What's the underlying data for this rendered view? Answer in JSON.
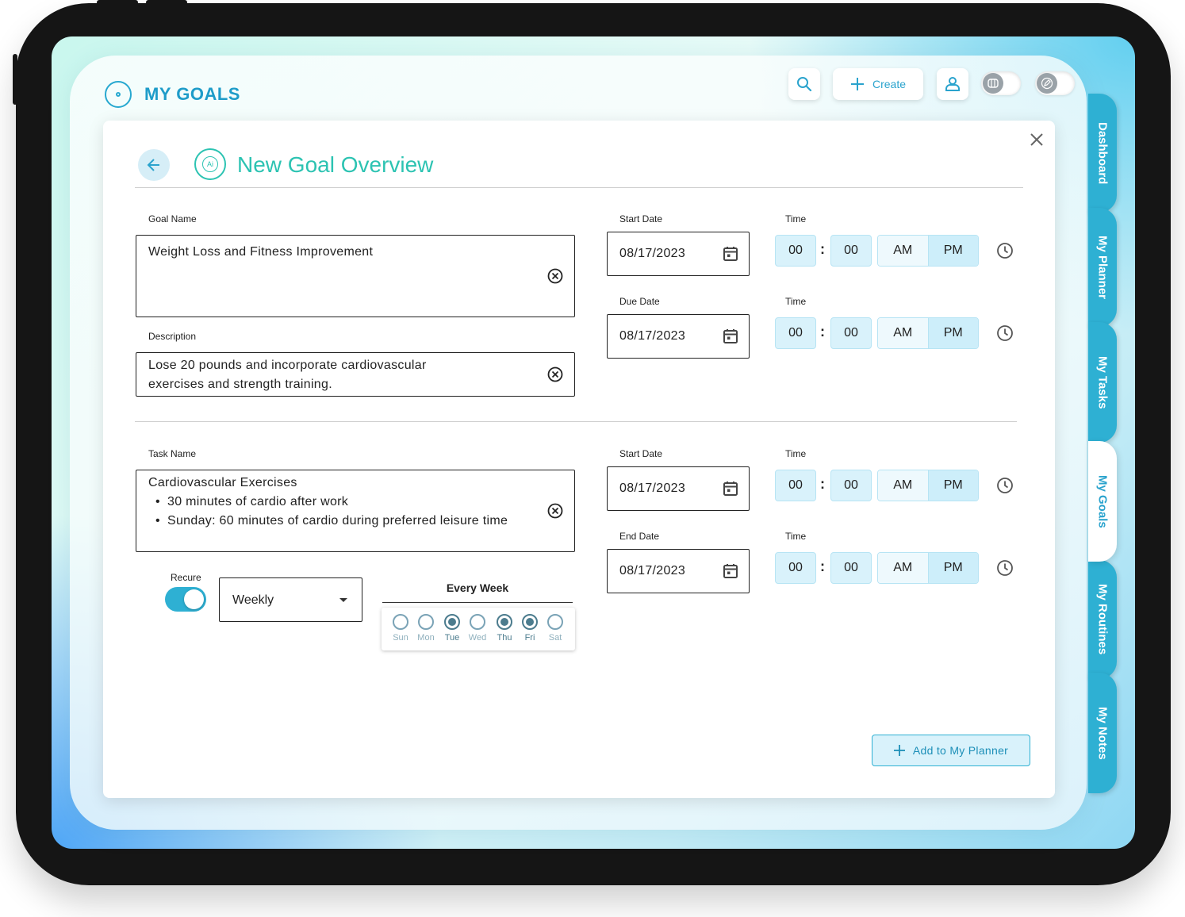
{
  "header": {
    "title": "MY GOALS",
    "create_label": "Create"
  },
  "tabs": [
    {
      "label": "Dashboard",
      "active": false
    },
    {
      "label": "My Planner",
      "active": false
    },
    {
      "label": "My Tasks",
      "active": false
    },
    {
      "label": "My Goals",
      "active": true
    },
    {
      "label": "My Routines",
      "active": false
    },
    {
      "label": "My Notes",
      "active": false
    }
  ],
  "card": {
    "title": "New Goal Overview",
    "goal_name_label": "Goal Name",
    "goal_name_value": "Weight Loss and Fitness Improvement",
    "description_label": "Description",
    "description_value": "Lose 20 pounds and incorporate cardiovascular exercises and strength training.",
    "task_name_label": "Task Name",
    "task_name_value": "Cardiovascular Exercises",
    "task_bullets": [
      "30 minutes of cardio after work",
      "Sunday: 60 minutes of cardio during preferred leisure time"
    ],
    "goal_start": {
      "label": "Start Date",
      "date": "08/17/2023",
      "time_label": "Time",
      "hour": "00",
      "minute": "00",
      "am": "AM",
      "pm": "PM",
      "selected": "PM"
    },
    "goal_due": {
      "label": "Due Date",
      "date": "08/17/2023",
      "time_label": "Time",
      "hour": "00",
      "minute": "00",
      "am": "AM",
      "pm": "PM",
      "selected": "PM"
    },
    "task_start": {
      "label": "Start Date",
      "date": "08/17/2023",
      "time_label": "Time",
      "hour": "00",
      "minute": "00",
      "am": "AM",
      "pm": "PM",
      "selected": "PM"
    },
    "task_end": {
      "label": "End Date",
      "date": "08/17/2023",
      "time_label": "Time",
      "hour": "00",
      "minute": "00",
      "am": "AM",
      "pm": "PM",
      "selected": "PM"
    },
    "recure_label": "Recure",
    "recure_on": true,
    "frequency": "Weekly",
    "every_week_label": "Every Week",
    "days": [
      {
        "label": "Sun",
        "checked": false
      },
      {
        "label": "Mon",
        "checked": false
      },
      {
        "label": "Tue",
        "checked": true
      },
      {
        "label": "Wed",
        "checked": false
      },
      {
        "label": "Thu",
        "checked": true
      },
      {
        "label": "Fri",
        "checked": true
      },
      {
        "label": "Sat",
        "checked": false
      }
    ],
    "add_button_label": "Add to My Planner"
  },
  "colors": {
    "accent": "#2eb0d3",
    "title_teal": "#2cc3b2",
    "time_box": "#d9f2fb"
  }
}
